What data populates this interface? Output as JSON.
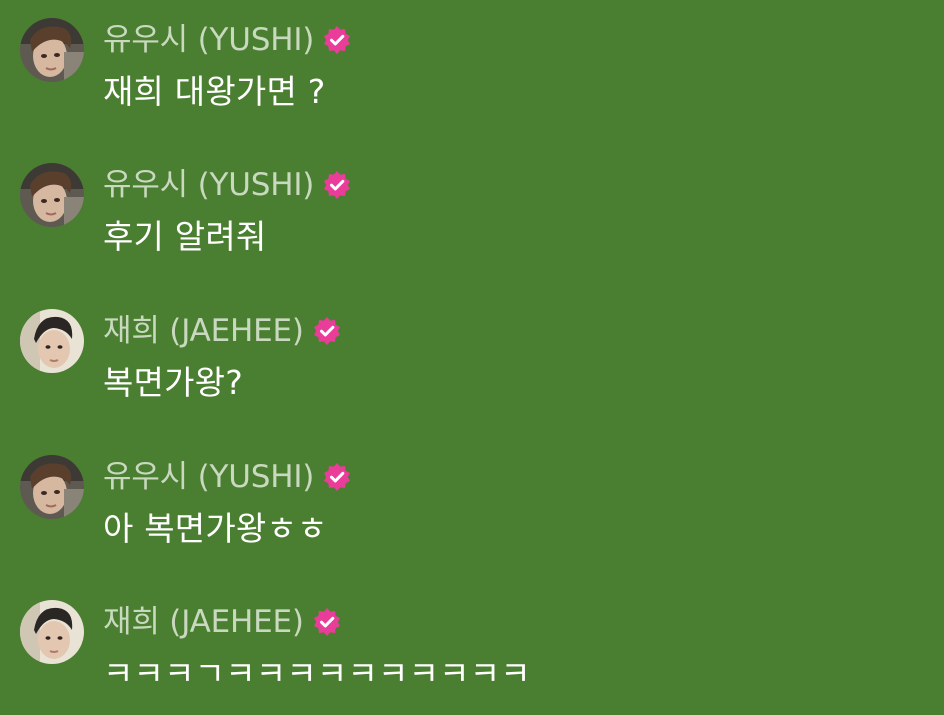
{
  "colors": {
    "background": "#4a7e30",
    "sender_name": "#c9d9bf",
    "message_text": "#ffffff",
    "verified_badge": "#ea3d9a"
  },
  "messages": [
    {
      "sender": "유우시 (YUSHI)",
      "avatar": "yushi-avatar",
      "verified": true,
      "text": "재희 대왕가면 ?"
    },
    {
      "sender": "유우시 (YUSHI)",
      "avatar": "yushi-avatar",
      "verified": true,
      "text": "후기 알려줘"
    },
    {
      "sender": "재희 (JAEHEE)",
      "avatar": "jaehee-avatar",
      "verified": true,
      "text": "복면가왕?"
    },
    {
      "sender": "유우시 (YUSHI)",
      "avatar": "yushi-avatar",
      "verified": true,
      "text": "아 복면가왕ㅎㅎ"
    },
    {
      "sender": "재희 (JAEHEE)",
      "avatar": "jaehee-avatar",
      "verified": true,
      "text": "ㅋㅋㅋㄱㅋㅋㅋㅋㅋㅋㅋㅋㅋㅋ"
    }
  ]
}
